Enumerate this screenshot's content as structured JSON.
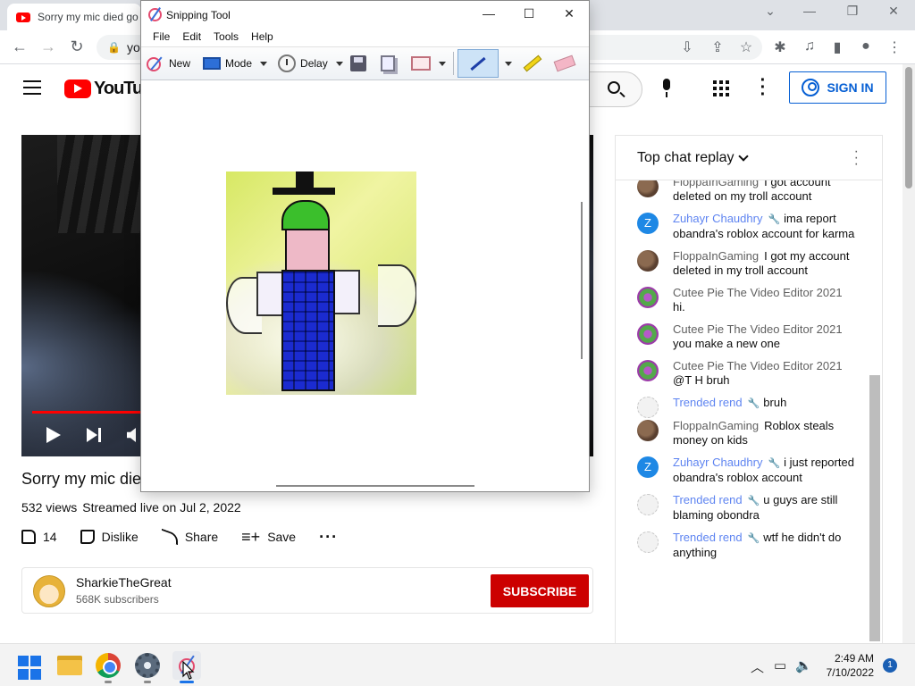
{
  "browser": {
    "tab_title": "Sorry my mic died go",
    "url_fragment": "yo"
  },
  "youtube": {
    "logo_text": "YouTube",
    "sign_in": "SIGN IN",
    "video": {
      "title": "Sorry my mic die",
      "views": "532 views",
      "streamed": "Streamed live on Jul 2, 2022",
      "likes": "14",
      "dislike_label": "Dislike",
      "share_label": "Share",
      "save_label": "Save",
      "progress_fraction": 0.2
    },
    "channel": {
      "name": "SharkieTheGreat",
      "subscribers": "568K subscribers",
      "subscribe_label": "SUBSCRIBE"
    },
    "chat": {
      "header": "Top chat replay",
      "messages": [
        {
          "author": "FloppaInGaming",
          "text": "I got account deleted on my troll account",
          "avatar": "floppa",
          "moderator": false
        },
        {
          "author": "Zuhayr Chaudhry",
          "text": "ima report obandra's roblox account for karma",
          "avatar": "z",
          "avatar_letter": "Z",
          "moderator": true
        },
        {
          "author": "FloppaInGaming",
          "text": "I got my account deleted in my troll account",
          "avatar": "floppa",
          "moderator": false
        },
        {
          "author": "Cutee Pie The Video Editor 2021",
          "text": "hi.",
          "avatar": "cutee",
          "moderator": false
        },
        {
          "author": "Cutee Pie The Video Editor 2021",
          "text": "you make a new one",
          "avatar": "cutee",
          "moderator": false
        },
        {
          "author": "Cutee Pie The Video Editor 2021",
          "text": "@T H bruh",
          "avatar": "cutee",
          "moderator": false
        },
        {
          "author": "Trended rend",
          "text": "bruh",
          "avatar": "trended",
          "moderator": true
        },
        {
          "author": "FloppaInGaming",
          "text": "Roblox steals money on kids",
          "avatar": "floppa",
          "moderator": false
        },
        {
          "author": "Zuhayr Chaudhry",
          "text": "i just reported obandra's roblox account",
          "avatar": "z",
          "avatar_letter": "Z",
          "moderator": true
        },
        {
          "author": "Trended rend",
          "text": "u guys are still blaming obondra",
          "avatar": "trended",
          "moderator": true
        },
        {
          "author": "Trended rend",
          "text": "wtf he didn't do anything",
          "avatar": "trended",
          "moderator": true
        }
      ]
    }
  },
  "snipping_tool": {
    "title": "Snipping Tool",
    "menu": [
      "File",
      "Edit",
      "Tools",
      "Help"
    ],
    "toolbar": {
      "new_label": "New",
      "mode_label": "Mode",
      "delay_label": "Delay"
    }
  },
  "taskbar": {
    "time": "2:49 AM",
    "date": "7/10/2022",
    "notification_count": "1"
  },
  "colors": {
    "youtube_red": "#ff0000",
    "subscribe_red": "#cc0000",
    "signin_blue": "#065fd4",
    "moderator_blue": "#5e84f1"
  }
}
